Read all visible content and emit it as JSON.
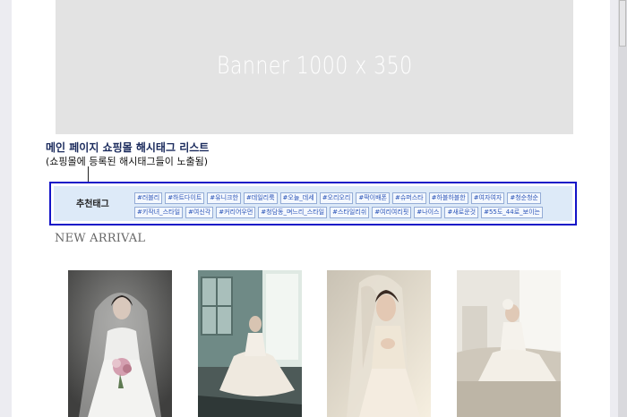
{
  "banner": {
    "text": "Banner 1000 x 350"
  },
  "annotation": {
    "title": "메인 페이지 쇼핑몰 해시태그 리스트",
    "subtitle": "(쇼핑몰에 등록된 해시태그들이 노출됨)"
  },
  "hashtag_box": {
    "label": "추천태그",
    "tags": [
      "#러블리",
      "#하트다이트",
      "#유니크한",
      "#데일리룩",
      "#오늘_데세",
      "#오리오리",
      "#팍이배폰",
      "#슈퍼스타",
      "#하블하블한",
      "#여자여자",
      "#청순청순",
      "#키작녀_스타일",
      "#여신각",
      "#커리어우먼",
      "#청담동_며느리_스타일",
      "#스타일리쉬",
      "#여리여리핏",
      "#나이스",
      "#새로운것",
      "#55도_44로_보이는"
    ]
  },
  "new_arrival": {
    "title": "NEW ARRIVAL",
    "products": [
      {
        "image": "bride-bouquet-photo"
      },
      {
        "image": "bride-window-room-photo"
      },
      {
        "image": "bride-veil-closeup-photo"
      },
      {
        "image": "bride-sofa-photo"
      }
    ]
  },
  "colors": {
    "highlight_border": "#1414c8",
    "tag_panel_bg": "#ddeaf8",
    "tag_text": "#2b55b8",
    "banner_bg": "#e3e3e3"
  }
}
